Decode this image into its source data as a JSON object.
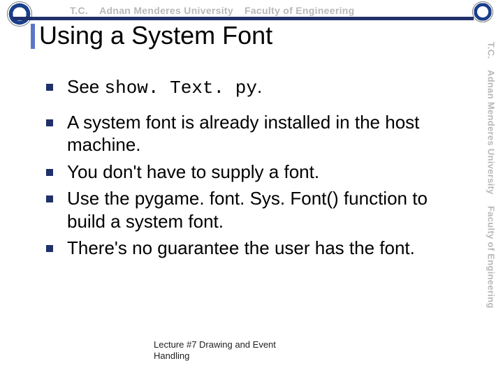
{
  "branding": {
    "tc": "T.C.",
    "university": "Adnan Menderes University",
    "faculty": "Faculty of Engineering"
  },
  "title": "Using a System Font",
  "bullets": [
    {
      "prefix": "See ",
      "code": "show. Text. py",
      "suffix": "."
    },
    {
      "text": "A system font is already installed in the host machine."
    },
    {
      "text": "You don't have to supply a font."
    },
    {
      "text": "Use the pygame. font. Sys. Font() function to build a system font."
    },
    {
      "text": "There's no guarantee the user has the font."
    }
  ],
  "footer": {
    "line1": "Lecture #7 Drawing and Event",
    "line2": "Handling"
  }
}
